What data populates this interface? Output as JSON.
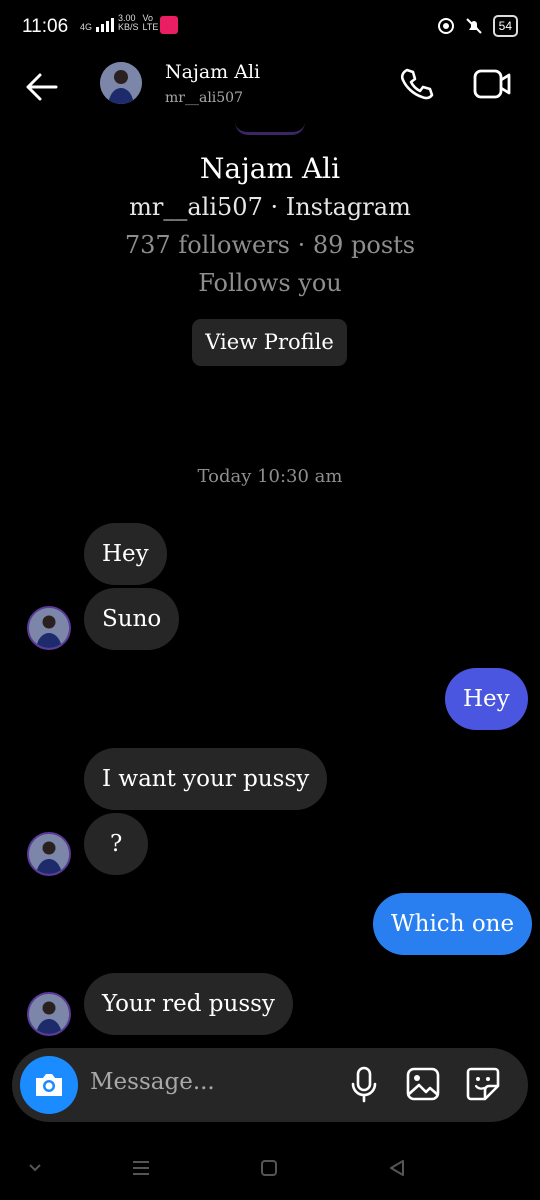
{
  "status_bar": {
    "time": "11:06",
    "network": "4G",
    "speed_value": "3.00",
    "speed_unit": "KB/S",
    "volte_top": "Vo",
    "volte_bottom": "LTE",
    "battery": "54"
  },
  "header": {
    "name": "Najam Ali",
    "username": "mr__ali507"
  },
  "profile": {
    "name": "Najam Ali",
    "username_line": "mr__ali507 · Instagram",
    "stats": "737 followers · 89 posts",
    "follows": "Follows you",
    "view_profile": "View Profile"
  },
  "timestamp": "Today 10:30 am",
  "messages": [
    {
      "text": "Hey",
      "dir": "in"
    },
    {
      "text": "Suno",
      "dir": "in"
    },
    {
      "text": "Hey",
      "dir": "out"
    },
    {
      "text": "I want your pussy",
      "dir": "in"
    },
    {
      "text": "?",
      "dir": "in"
    },
    {
      "text": "Which one",
      "dir": "out"
    },
    {
      "text": "Your red pussy",
      "dir": "in"
    }
  ],
  "composer": {
    "placeholder": "Message..."
  },
  "colors": {
    "accent": "#1a8cff",
    "out_bubble_1": "#4a55e0",
    "out_bubble_2": "#2a7ff0",
    "in_bubble": "#262626"
  }
}
